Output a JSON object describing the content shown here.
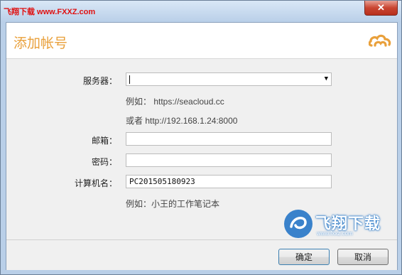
{
  "titlebar": {
    "watermark": "飞翔下载 www.FXXZ.com",
    "close_glyph": "✕"
  },
  "header": {
    "title": "添加帐号",
    "logo_icon": "seafile-cloud-icon"
  },
  "form": {
    "server_label": "服务器：",
    "server_value": "",
    "server_hint1": "例如： https://seacloud.cc",
    "server_hint2": "或者 http://192.168.1.24:8000",
    "email_label": "邮箱：",
    "email_value": "",
    "password_label": "密码：",
    "password_value": "",
    "computer_name_label": "计算机名：",
    "computer_name_value": "PC201505180923",
    "computer_name_hint": "例如：小王的工作笔记本"
  },
  "footer": {
    "ok_label": "确定",
    "cancel_label": "取消"
  },
  "watermark": {
    "brand": "飞翔下载",
    "url": "www.fxxz.com"
  },
  "colors": {
    "accent": "#e9a03b",
    "close": "#c94531",
    "watermark_red": "#e01010"
  }
}
